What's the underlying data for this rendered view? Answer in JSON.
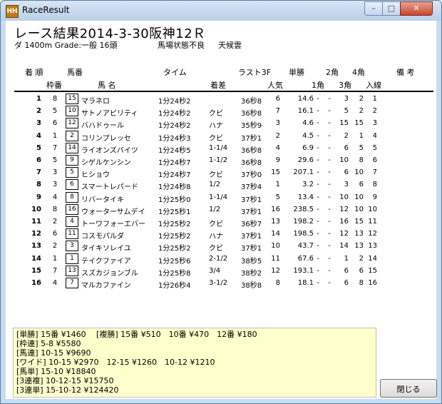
{
  "window": {
    "title": "RaceResult",
    "icon": "HH",
    "controls": {
      "minimize": "–",
      "maximize": "□",
      "close": "✕"
    }
  },
  "heading": "レース結果2014-3-30阪神12Ｒ",
  "info": {
    "course": "ダ 1400m Grade:一般 16頭",
    "condition": "馬場状態不良",
    "weather": "天候雲"
  },
  "header1": {
    "pos": "着 順",
    "num": "馬番",
    "time": "タイム",
    "last3f": "ラスト3F",
    "win": "単勝",
    "c2": "2角",
    "c4": "4角",
    "remarks": "備 考"
  },
  "header2": {
    "waku": "枠番",
    "name": "馬 名",
    "margin": "着差",
    "popularity": "人気",
    "c1": "1角",
    "c3": "3角",
    "final": "入線"
  },
  "rows": [
    {
      "pos": "1",
      "waku": "8",
      "num": "15",
      "name": "マラネロ",
      "time": "1分24秒2",
      "margin": "",
      "l3f": "36秒8",
      "pop": "6",
      "odds": "14.6",
      "c1": "-",
      "c2": "-",
      "c3": "3",
      "c4": "2",
      "fin": "1"
    },
    {
      "pos": "2",
      "waku": "5",
      "num": "10",
      "name": "サトノアビリティ",
      "time": "1分24秒2",
      "margin": "クビ",
      "l3f": "36秒8",
      "pop": "7",
      "odds": "16.1",
      "c1": "-",
      "c2": "-",
      "c3": "5",
      "c4": "2",
      "fin": "2"
    },
    {
      "pos": "3",
      "waku": "6",
      "num": "12",
      "name": "バハドゥール",
      "time": "1分24秒2",
      "margin": "ハナ",
      "l3f": "35秒9",
      "pop": "3",
      "odds": "4.6",
      "c1": "-",
      "c2": "-",
      "c3": "15",
      "c4": "15",
      "fin": "3"
    },
    {
      "pos": "4",
      "waku": "1",
      "num": "2",
      "name": "コリンプレッセ",
      "time": "1分24秒3",
      "margin": "クビ",
      "l3f": "37秒1",
      "pop": "2",
      "odds": "4.5",
      "c1": "-",
      "c2": "-",
      "c3": "2",
      "c4": "1",
      "fin": "4"
    },
    {
      "pos": "5",
      "waku": "7",
      "num": "14",
      "name": "ライオンズバイツ",
      "time": "1分24秒5",
      "margin": "1-1/4",
      "l3f": "36秒8",
      "pop": "4",
      "odds": "6.9",
      "c1": "-",
      "c2": "-",
      "c3": "6",
      "c4": "5",
      "fin": "5"
    },
    {
      "pos": "6",
      "waku": "5",
      "num": "9",
      "name": "シゲルケンシン",
      "time": "1分24秒7",
      "margin": "1-1/2",
      "l3f": "36秒8",
      "pop": "9",
      "odds": "29.6",
      "c1": "-",
      "c2": "-",
      "c3": "10",
      "c4": "8",
      "fin": "6"
    },
    {
      "pos": "7",
      "waku": "3",
      "num": "5",
      "name": "ヒショウ",
      "time": "1分24秒7",
      "margin": "クビ",
      "l3f": "37秒0",
      "pop": "15",
      "odds": "207.1",
      "c1": "-",
      "c2": "-",
      "c3": "6",
      "c4": "10",
      "fin": "7"
    },
    {
      "pos": "8",
      "waku": "3",
      "num": "6",
      "name": "スマートレパード",
      "time": "1分24秒8",
      "margin": "1/2",
      "l3f": "37秒4",
      "pop": "1",
      "odds": "3.2",
      "c1": "-",
      "c2": "-",
      "c3": "3",
      "c4": "6",
      "fin": "8"
    },
    {
      "pos": "9",
      "waku": "4",
      "num": "8",
      "name": "リバータイキ",
      "time": "1分25秒0",
      "margin": "1-1/4",
      "l3f": "37秒1",
      "pop": "5",
      "odds": "13.4",
      "c1": "-",
      "c2": "-",
      "c3": "10",
      "c4": "10",
      "fin": "9"
    },
    {
      "pos": "10",
      "waku": "8",
      "num": "16",
      "name": "ウォーターサムデイ",
      "time": "1分25秒1",
      "margin": "1/2",
      "l3f": "37秒1",
      "pop": "16",
      "odds": "238.5",
      "c1": "-",
      "c2": "-",
      "c3": "12",
      "c4": "10",
      "fin": "10"
    },
    {
      "pos": "11",
      "waku": "2",
      "num": "4",
      "name": "トーワフォーエバー",
      "time": "1分25秒2",
      "margin": "クビ",
      "l3f": "36秒7",
      "pop": "13",
      "odds": "198.2",
      "c1": "-",
      "c2": "-",
      "c3": "16",
      "c4": "15",
      "fin": "11"
    },
    {
      "pos": "12",
      "waku": "6",
      "num": "11",
      "name": "コスモパルダ",
      "time": "1分25秒2",
      "margin": "ハナ",
      "l3f": "37秒1",
      "pop": "14",
      "odds": "198.5",
      "c1": "-",
      "c2": "-",
      "c3": "12",
      "c4": "13",
      "fin": "12"
    },
    {
      "pos": "13",
      "waku": "2",
      "num": "3",
      "name": "タイキソレイユ",
      "time": "1分25秒2",
      "margin": "クビ",
      "l3f": "37秒1",
      "pop": "10",
      "odds": "43.7",
      "c1": "-",
      "c2": "-",
      "c3": "14",
      "c4": "13",
      "fin": "13"
    },
    {
      "pos": "14",
      "waku": "1",
      "num": "1",
      "name": "テイクファイア",
      "time": "1分25秒6",
      "margin": "2-1/2",
      "l3f": "38秒5",
      "pop": "11",
      "odds": "67.6",
      "c1": "-",
      "c2": "-",
      "c3": "1",
      "c4": "2",
      "fin": "14"
    },
    {
      "pos": "15",
      "waku": "7",
      "num": "13",
      "name": "スズカジョンブル",
      "time": "1分25秒8",
      "margin": "3/4",
      "l3f": "38秒2",
      "pop": "12",
      "odds": "193.1",
      "c1": "-",
      "c2": "-",
      "c3": "6",
      "c4": "6",
      "fin": "15"
    },
    {
      "pos": "16",
      "waku": "4",
      "num": "7",
      "name": "マルカファイン",
      "time": "1分26秒4",
      "margin": "3-1/2",
      "l3f": "38秒8",
      "pop": "8",
      "odds": "18.1",
      "c1": "-",
      "c2": "-",
      "c3": "6",
      "c4": "8",
      "fin": "16"
    }
  ],
  "payouts": [
    "[単勝] 15番 ¥1460　 [複勝] 15番 ¥510　10番 ¥470　12番 ¥180",
    "[枠連] 5-8 ¥5580",
    "[馬連] 10-15 ¥9690",
    "[ワイド] 10-15 ¥2970　12-15 ¥1260　10-12 ¥1210",
    "[馬単] 15-10 ¥18840",
    "[3連複] 10-12-15 ¥15750",
    "[3連単] 15-10-12 ¥124420"
  ],
  "close_button": "閉じる"
}
